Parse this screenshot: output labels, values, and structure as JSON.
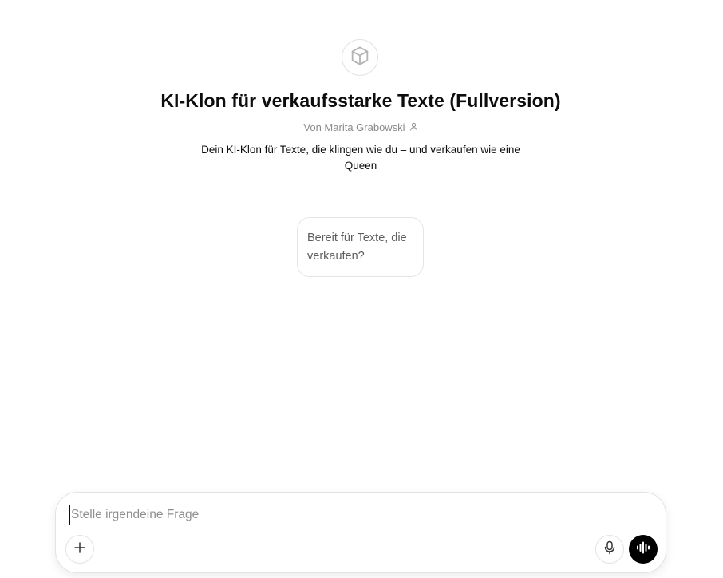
{
  "gpt": {
    "icon": "cube-icon",
    "title": "KI-Klon für verkaufsstarke Texte (Fullversion)",
    "author": "Von Marita Grabowski",
    "author_icon": "person-icon",
    "description": "Dein KI-Klon für Texte, die klingen wie du – und verkaufen wie eine Queen"
  },
  "conversation_starters": [
    {
      "label": "Bereit für Texte, die verkaufen?"
    }
  ],
  "composer": {
    "placeholder": "Stelle irgendeine Frage",
    "value": "",
    "buttons": {
      "add_icon": "plus-icon",
      "dictate_icon": "microphone-icon",
      "voice_icon": "voice-wave-icon"
    }
  },
  "colors": {
    "background": "#ffffff",
    "text": "#0d0d0d",
    "muted": "#8a8a8a",
    "border": "#e3e3e3",
    "voice_button": "#000000"
  }
}
